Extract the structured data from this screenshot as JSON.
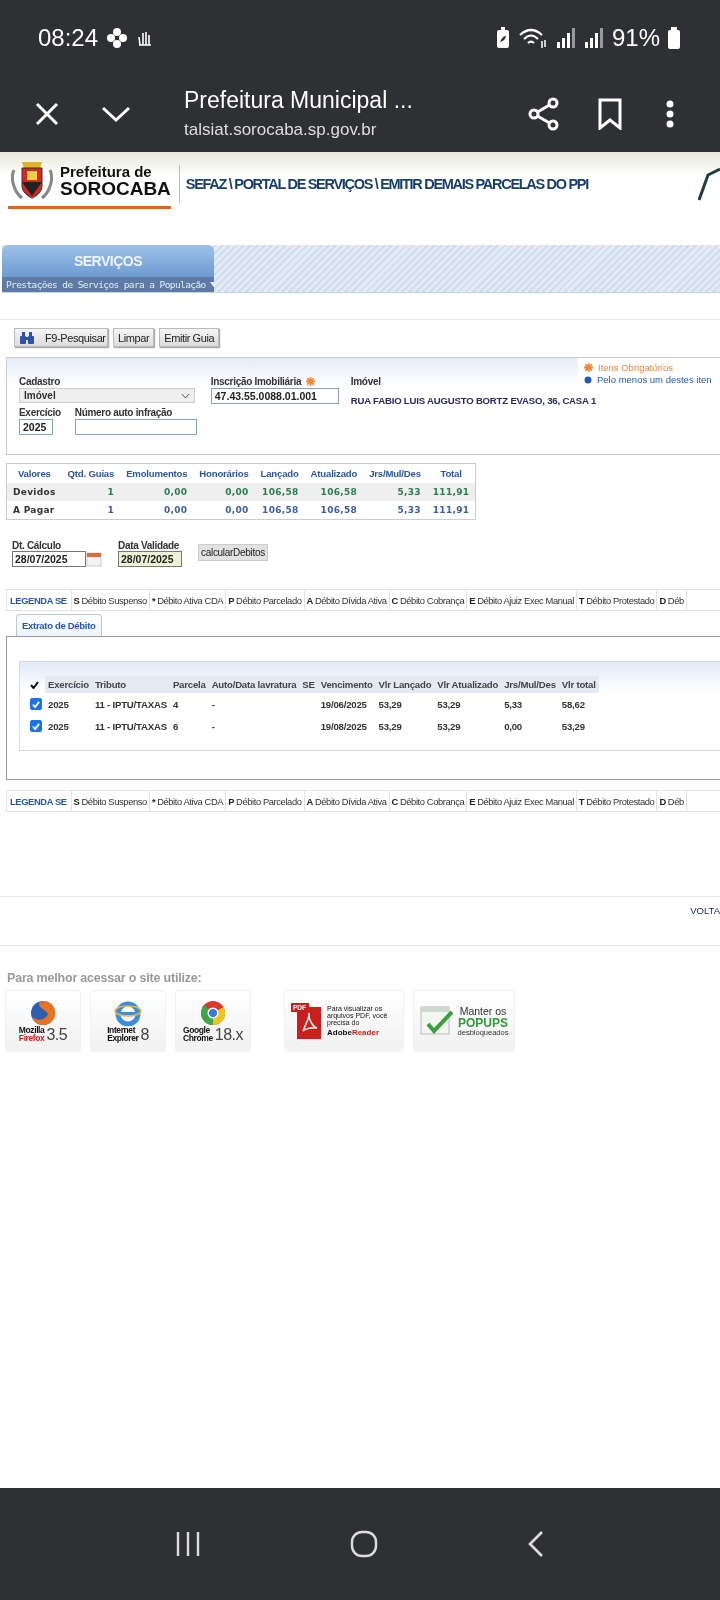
{
  "status_bar": {
    "time": "08:24",
    "battery": "91%"
  },
  "browser_toolbar": {
    "title": "Prefeitura Municipal ...",
    "url": "talsiat.sorocaba.sp.gov.br"
  },
  "header": {
    "logo_line1": "Prefeitura de",
    "logo_line2": "SOROCABA",
    "breadcrumb": "SEFAZ \\ PORTAL DE SERVIÇOS \\ EMITIR DEMAIS PARCELAS DO PPI"
  },
  "menu": {
    "title": "SERVIÇOS",
    "subtitle": "Prestações de Serviços para a População"
  },
  "action_buttons": [
    {
      "label": "F9-Pesquisar",
      "kind": "search"
    },
    {
      "label": "Limpar",
      "kind": "plain"
    },
    {
      "label": "Emitir Guia",
      "kind": "plain"
    }
  ],
  "form": {
    "cadastro_label": "Cadastro",
    "cadastro_value": "Imóvel",
    "inscricao_label": "Inscrição Imobiliária",
    "inscricao_value": "47.43.55.0088.01.001",
    "imovel_label": "Imóvel",
    "imovel_value": "RUA FABIO LUIS AUGUSTO BORTZ EVASO, 36, CASA 1",
    "exercicio_label": "Exercício",
    "exercicio_value": "2025",
    "auto_label": "Número auto infração"
  },
  "form_legend": [
    {
      "text": "Itens Obrigatórios",
      "kind": "required"
    },
    {
      "text": "Pelo menos um destes iten",
      "kind": "any"
    }
  ],
  "summary": {
    "columns": [
      "Valores",
      "Qtd. Guias",
      "Emolumentos",
      "Honorários",
      "Lançado",
      "Atualizado",
      "Jrs/Mul/Des",
      "Total"
    ],
    "rows": [
      {
        "label": "Devidos",
        "color": "#2e7d4f",
        "values": [
          "1",
          "0,00",
          "0,00",
          "106,58",
          "106,58",
          "5,33",
          "111,91"
        ]
      },
      {
        "label": "A Pagar",
        "color": "#3d5f9c",
        "values": [
          "1",
          "0,00",
          "0,00",
          "106,58",
          "106,58",
          "5,33",
          "111,91"
        ]
      }
    ]
  },
  "dates": {
    "calculo_label": "Dt. Cálculo",
    "calculo_value": "28/07/2025",
    "validade_label": "Data Validade",
    "validade_value": "28/07/2025",
    "button": "calcularDebitos"
  },
  "legend_top": {
    "title": "LEGENDA SE",
    "items": [
      {
        "code": "S",
        "text": "Débito Suspenso"
      },
      {
        "code": "*",
        "text": "Débito Ativa CDA"
      },
      {
        "code": "P",
        "text": "Débito Parcelado"
      },
      {
        "code": "A",
        "text": "Débito Dívida Ativa"
      },
      {
        "code": "C",
        "text": "Débito Cobrança"
      },
      {
        "code": "E",
        "text": "Débito Ajuiz Exec Manual"
      },
      {
        "code": "T",
        "text": "Débito Protestado"
      },
      {
        "code": "D",
        "text": "Déb"
      }
    ]
  },
  "tabs": [
    {
      "label": "Extrato de Débito",
      "selected": true
    }
  ],
  "debts": {
    "columns": [
      "Exercício",
      "Tributo",
      "Parcela",
      "Auto/Data lavratura",
      "SE",
      "Vencimento",
      "Vlr Lançado",
      "Vlr Atualizado",
      "Jrs/Mul/Des",
      "Vlr total"
    ],
    "rows": [
      {
        "checked": true,
        "cells": [
          "2025",
          "11 - IPTU/TAXAS",
          "4",
          "-",
          "",
          "19/06/2025",
          "53,29",
          "53,29",
          "5,33",
          "58,62"
        ]
      },
      {
        "checked": true,
        "cells": [
          "2025",
          "11 - IPTU/TAXAS",
          "6",
          "-",
          "",
          "19/08/2025",
          "53,29",
          "53,29",
          "0,00",
          "53,29"
        ]
      }
    ]
  },
  "legend_bottom": {
    "title": "LEGENDA SE",
    "items": [
      {
        "code": "S",
        "text": "Débito Suspenso"
      },
      {
        "code": "*",
        "text": "Débito Ativa CDA"
      },
      {
        "code": "P",
        "text": "Débito Parcelado"
      },
      {
        "code": "A",
        "text": "Débito Dívida Ativa"
      },
      {
        "code": "C",
        "text": "Débito Cobrança"
      },
      {
        "code": "E",
        "text": "Débito Ajuiz Exec Manual"
      },
      {
        "code": "T",
        "text": "Débito Protestado"
      },
      {
        "code": "D",
        "text": "Déb"
      }
    ]
  },
  "footer": {
    "back_link": "VOLTA",
    "recommend": "Para melhor acessar o site utilize:",
    "badges": [
      {
        "kind": "firefox",
        "lines": [
          "Mozilla",
          "Firefox",
          "3.5"
        ]
      },
      {
        "kind": "ie",
        "lines": [
          "Internet",
          "Explorer",
          "8"
        ]
      },
      {
        "kind": "chrome",
        "lines": [
          "Google",
          "Chrome",
          "18.x"
        ]
      },
      {
        "kind": "pdf",
        "lines": [
          "PDF",
          "Para visualizar os arquivos PDF, você precisa do",
          "Adobe",
          "Reader"
        ]
      },
      {
        "kind": "popups",
        "lines": [
          "Manter os",
          "POPUPS",
          "desbloqueados"
        ]
      }
    ]
  }
}
